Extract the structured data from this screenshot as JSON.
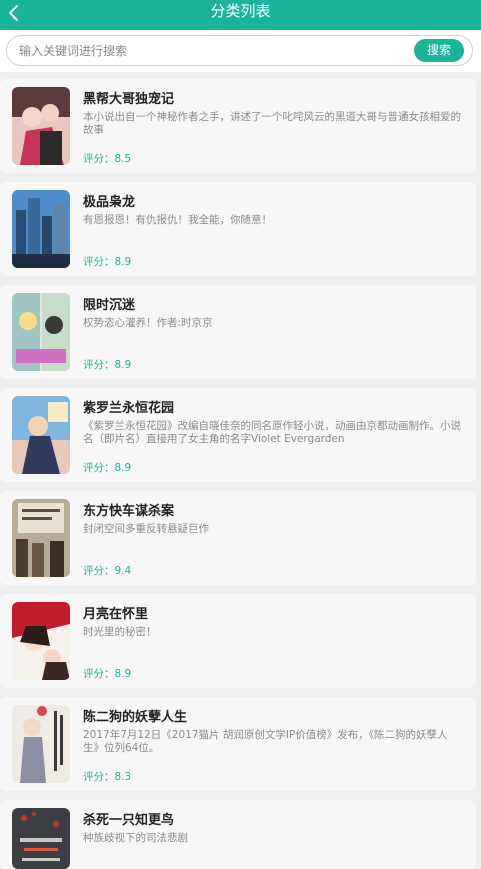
{
  "header": {
    "title": "分类列表",
    "back_icon": "chevron-left-icon"
  },
  "search": {
    "placeholder": "输入关键词进行搜索",
    "button_label": "搜索"
  },
  "colors": {
    "accent": "#19b49a",
    "background": "#eeeeee",
    "card": "#f7f7f7"
  },
  "books": [
    {
      "title": "黑帮大哥独宠记",
      "desc": "本小说出自一个神秘作者之手，讲述了一个叱咤风云的黑道大哥与普通女孩相爱的故事",
      "rating": "评分：8.5"
    },
    {
      "title": "极品枭龙",
      "desc": "有恩报恩！有仇报仇！我全能，你随意！",
      "rating": "评分：8.9"
    },
    {
      "title": "限时沉迷",
      "desc": "权势恣心灌养！作者:时京京",
      "rating": "评分：8.9"
    },
    {
      "title": "紫罗兰永恒花园",
      "desc": "《紫罗兰永恒花园》改编自晓佳奈的同名原作轻小说，动画由京都动画制作。小说名（即片名）直接用了女主角的名字Violet Evergarden",
      "rating": "评分：8.9"
    },
    {
      "title": "东方快车谋杀案",
      "desc": "封闭空间多重反转悬疑巨作",
      "rating": "评分：9.4"
    },
    {
      "title": "月亮在怀里",
      "desc": "时光里的秘密！",
      "rating": "评分：8.9"
    },
    {
      "title": "陈二狗的妖孽人生",
      "desc": "2017年7月12日《2017猫片 胡润原创文学IP价值榜》发布，《陈二狗的妖孽人生》位列64位。",
      "rating": "评分：8.3"
    },
    {
      "title": "杀死一只知更鸟",
      "desc": "种族歧视下的司法悲剧",
      "rating": ""
    }
  ]
}
